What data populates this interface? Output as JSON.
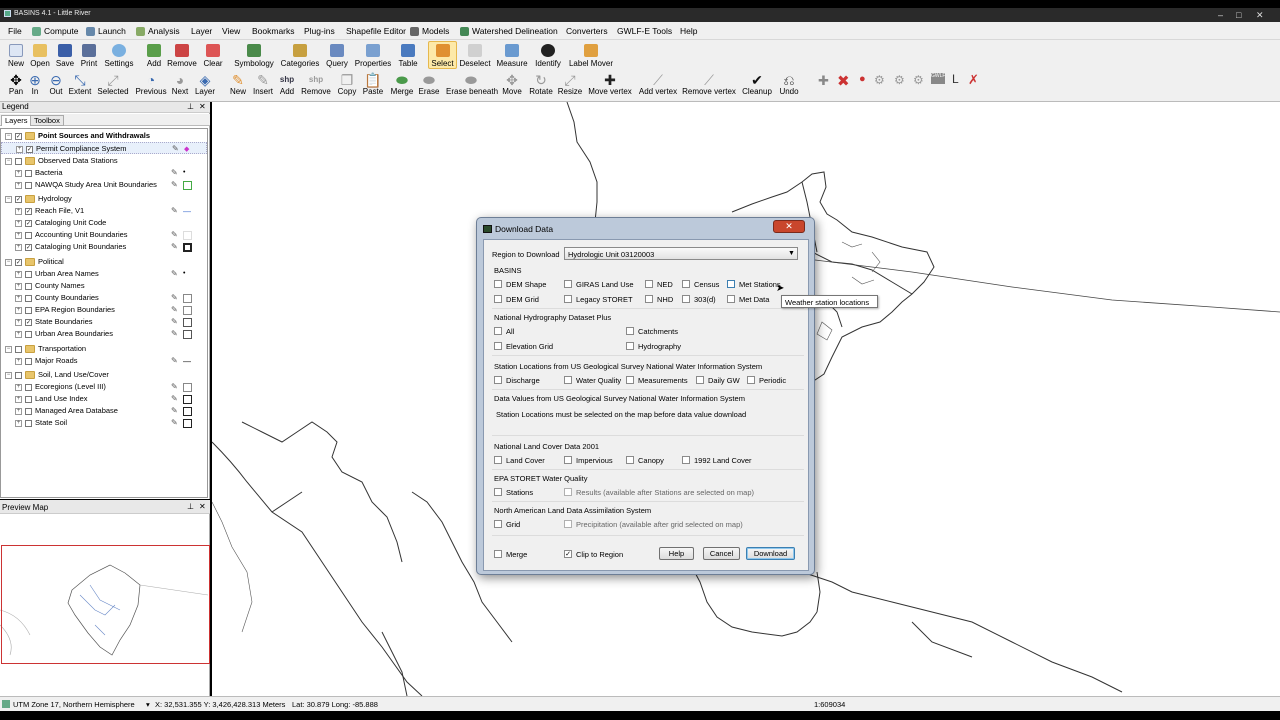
{
  "window": {
    "title": "BASINS 4.1 - Little River"
  },
  "menu": [
    "File",
    "Compute",
    "Launch",
    "Analysis",
    "Layer",
    "View",
    "Bookmarks",
    "Plug-ins",
    "Shapefile Editor",
    "Models",
    "Watershed Delineation",
    "Converters",
    "GWLF-E Tools",
    "Help"
  ],
  "toolbar1": [
    "New",
    "Open",
    "Save",
    "Print",
    "Settings",
    "Add",
    "Remove",
    "Clear",
    "Symbology",
    "Categories",
    "Query",
    "Properties",
    "Table",
    "Select",
    "Deselect",
    "Measure",
    "Identify",
    "Label Mover"
  ],
  "toolbar2": [
    "Pan",
    "In",
    "Out",
    "Extent",
    "Selected",
    "Previous",
    "Next",
    "Layer",
    "New",
    "Insert",
    "Add",
    "Remove",
    "Copy",
    "Paste",
    "Merge",
    "Erase",
    "Erase beneath",
    "Move",
    "Rotate",
    "Resize",
    "Move vertex",
    "Add vertex",
    "Remove vertex",
    "Cleanup",
    "Undo"
  ],
  "legend": {
    "title": "Legend",
    "tabs": [
      "Layers",
      "Toolbox"
    ],
    "groups": [
      {
        "name": "Point Sources and Withdrawals",
        "layers": [
          "Permit Compliance System"
        ]
      },
      {
        "name": "Observed Data Stations",
        "layers": [
          "Bacteria",
          "NAWQA Study Area Unit Boundaries"
        ]
      },
      {
        "name": "Hydrology",
        "layers": [
          "Reach File, V1",
          "Cataloging Unit Code",
          "Accounting Unit Boundaries",
          "Cataloging Unit Boundaries"
        ]
      },
      {
        "name": "Political",
        "layers": [
          "Urban Area Names",
          "County Names",
          "County Boundaries",
          "EPA Region Boundaries",
          "State Boundaries",
          "Urban Area Boundaries"
        ]
      },
      {
        "name": "Transportation",
        "layers": [
          "Major Roads"
        ]
      },
      {
        "name": "Soil, Land Use/Cover",
        "layers": [
          "Ecoregions (Level III)",
          "Land Use Index",
          "Managed Area Database",
          "State Soil"
        ]
      }
    ]
  },
  "preview": {
    "title": "Preview Map"
  },
  "status": {
    "projection": "UTM Zone 17, Northern Hemisphere",
    "coords": "X: 32,531.355 Y: 3,426,428.313 Meters",
    "latlong": "Lat: 30.879 Long: -85.888",
    "scale": "1:609034"
  },
  "dialog": {
    "title": "Download Data",
    "close": "✕",
    "region_label": "Region to Download",
    "region_value": "Hydrologic Unit 03120003",
    "basins": {
      "title": "BASINS",
      "items": [
        "DEM Shape",
        "GIRAS Land Use",
        "NED",
        "Census",
        "Met Stations",
        "DEM Grid",
        "Legacy STORET",
        "NHD",
        "303(d)",
        "Met Data"
      ]
    },
    "nhdplus": {
      "title": "National Hydrography Dataset Plus",
      "items": [
        "All",
        "Catchments",
        "Elevation Grid",
        "Hydrography"
      ]
    },
    "nwis_stations": {
      "title": "Station Locations from US Geological Survey National Water Information System",
      "items": [
        "Discharge",
        "Water Quality",
        "Measurements",
        "Daily GW",
        "Periodic"
      ]
    },
    "nwis_values": {
      "title": "Data Values from US Geological Survey National Water Information System",
      "note": "Station Locations must be selected on the map before data value download"
    },
    "nlcd": {
      "title": "National Land Cover Data 2001",
      "items": [
        "Land Cover",
        "Impervious",
        "Canopy",
        "1992 Land Cover"
      ]
    },
    "storet": {
      "title": "EPA STORET Water Quality",
      "items": [
        "Stations",
        "Results (available after Stations are selected on map)"
      ]
    },
    "nldas": {
      "title": "North American Land Data Assimilation System",
      "items": [
        "Grid",
        "Precipitation (available after grid selected on map)"
      ]
    },
    "merge": "Merge",
    "clip": "Clip to Region",
    "buttons": [
      "Help",
      "Cancel",
      "Download"
    ]
  },
  "tooltip": "Weather station locations"
}
